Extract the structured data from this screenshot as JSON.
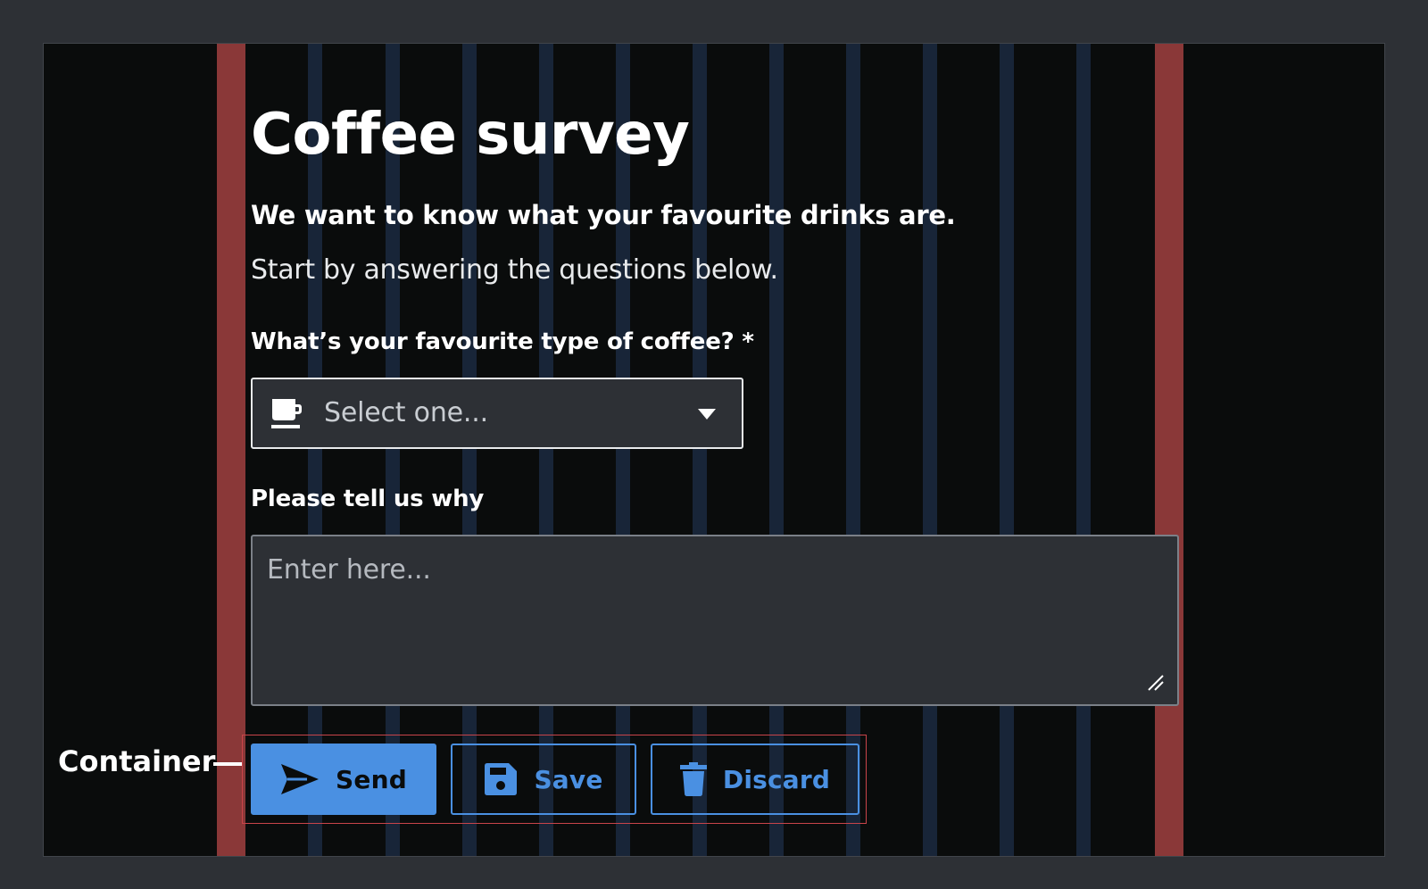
{
  "page": {
    "title": "Coffee survey",
    "lead": "We want to know what your favourite drinks are.",
    "intro": "Start by answering the questions below."
  },
  "form": {
    "coffee_label": "What’s your favourite type of coffee? *",
    "coffee_select": {
      "value": "Select one...",
      "icon": "coffee-cup-icon"
    },
    "why_label": "Please tell us why",
    "why_placeholder": "Enter here..."
  },
  "buttons": {
    "send": {
      "label": "Send",
      "icon": "send-icon"
    },
    "save": {
      "label": "Save",
      "icon": "floppy-disk-icon"
    },
    "discard": {
      "label": "Discard",
      "icon": "trash-icon"
    }
  },
  "annotation": {
    "container_label": "Container"
  },
  "colors": {
    "accent": "#4a90e2",
    "page_background": "#0a0c0c",
    "margin_guide": "#8a3838",
    "gutter_guide": "#253a5c",
    "container_outline": "#c9444a",
    "field_background": "#2d3035"
  }
}
